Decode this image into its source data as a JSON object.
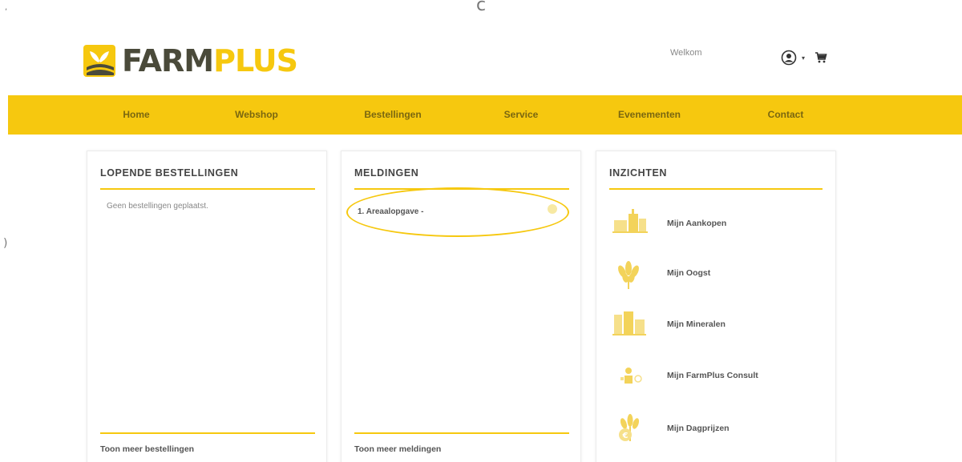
{
  "header": {
    "logo_text_farm": "FARM",
    "logo_text_plus": "PLUS",
    "welcome": "Welkom"
  },
  "nav": {
    "items": [
      "Home",
      "Webshop",
      "Bestellingen",
      "Service",
      "Evenementen",
      "Contact"
    ]
  },
  "panels": {
    "orders": {
      "title": "LOPENDE BESTELLINGEN",
      "empty_text": "Geen bestellingen geplaatst.",
      "footer": "Toon meer bestellingen"
    },
    "notifications": {
      "title": "MELDINGEN",
      "items": [
        "1.  Areaalopgave -"
      ],
      "footer": "Toon meer meldingen"
    },
    "insights": {
      "title": "INZICHTEN",
      "items": [
        {
          "label": "Mijn Aankopen",
          "icon": "purchases-icon"
        },
        {
          "label": "Mijn Oogst",
          "icon": "wheat-icon"
        },
        {
          "label": "Mijn Mineralen",
          "icon": "silo-icon"
        },
        {
          "label": "Mijn FarmPlus Consult",
          "icon": "consult-icon"
        },
        {
          "label": "Mijn Dagprijzen",
          "icon": "wheat-coin-icon"
        }
      ]
    }
  },
  "colors": {
    "brand_yellow": "#f6c80f",
    "brand_dark": "#4a4a3a",
    "nav_text": "#7a6710"
  }
}
